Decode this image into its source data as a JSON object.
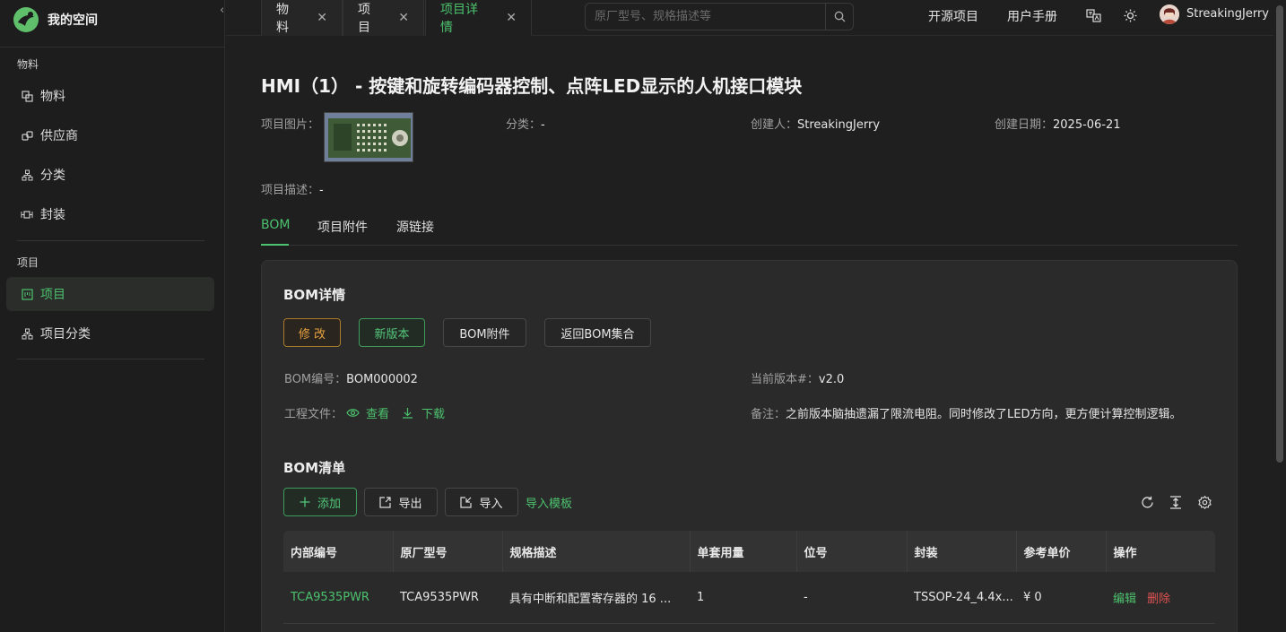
{
  "brand": {
    "name": "我的空间"
  },
  "sidebar": {
    "group_material": "物料",
    "group_project": "项目",
    "items": [
      {
        "label": "物料"
      },
      {
        "label": "供应商"
      },
      {
        "label": "分类"
      },
      {
        "label": "封装"
      },
      {
        "label": "项目"
      },
      {
        "label": "项目分类"
      }
    ],
    "collapse_icon": "chevron-left-icon"
  },
  "header": {
    "tabs": [
      {
        "label": "物料"
      },
      {
        "label": "项目"
      },
      {
        "label": "项目详情"
      }
    ],
    "search_placeholder": "原厂型号、规格描述等",
    "open_source": "开源项目",
    "manual": "用户手册",
    "username": "StreakingJerry"
  },
  "project": {
    "title": "HMI（1） - 按键和旋转编码器控制、点阵LED显示的人机接口模块",
    "image_label": "项目图片：",
    "category_label": "分类：",
    "category_value": "-",
    "creator_label": "创建人：",
    "creator_value": "StreakingJerry",
    "created_label": "创建日期：",
    "created_value": "2025-06-21",
    "desc_label": "项目描述：",
    "desc_value": "-"
  },
  "subtabs": [
    {
      "label": "BOM"
    },
    {
      "label": "项目附件"
    },
    {
      "label": "源链接"
    }
  ],
  "bom_detail": {
    "title": "BOM详情",
    "btn_edit": "修 改",
    "btn_new_version": "新版本",
    "btn_attachments": "BOM附件",
    "btn_back": "返回BOM集合",
    "number_label": "BOM编号：",
    "number_value": "BOM000002",
    "version_label": "当前版本#：",
    "version_value": "v2.0",
    "files_label": "工程文件：",
    "view": "查看",
    "download": "下载",
    "note_label": "备注：",
    "note_value": "之前版本脑抽遗漏了限流电阻。同时修改了LED方向，更方便计算控制逻辑。"
  },
  "bom_list": {
    "title": "BOM清单",
    "btn_add": "添加",
    "btn_export": "导出",
    "btn_import": "导入",
    "import_template": "导入模板",
    "columns": [
      "内部编号",
      "原厂型号",
      "规格描述",
      "单套用量",
      "位号",
      "封装",
      "参考单价",
      "操作"
    ],
    "rows": [
      {
        "internal_no": "TCA9535PWR",
        "mfr_part": "TCA9535PWR",
        "spec": "具有中断和配置寄存器的 16 ...",
        "qty": "1",
        "designator": "-",
        "package": "TSSOP-24_4.4x...",
        "price": "¥ 0",
        "edit": "编辑",
        "delete": "删除"
      }
    ]
  },
  "colors": {
    "accent": "#4cc26e",
    "warning": "#e7a23d",
    "danger": "#e05252"
  }
}
